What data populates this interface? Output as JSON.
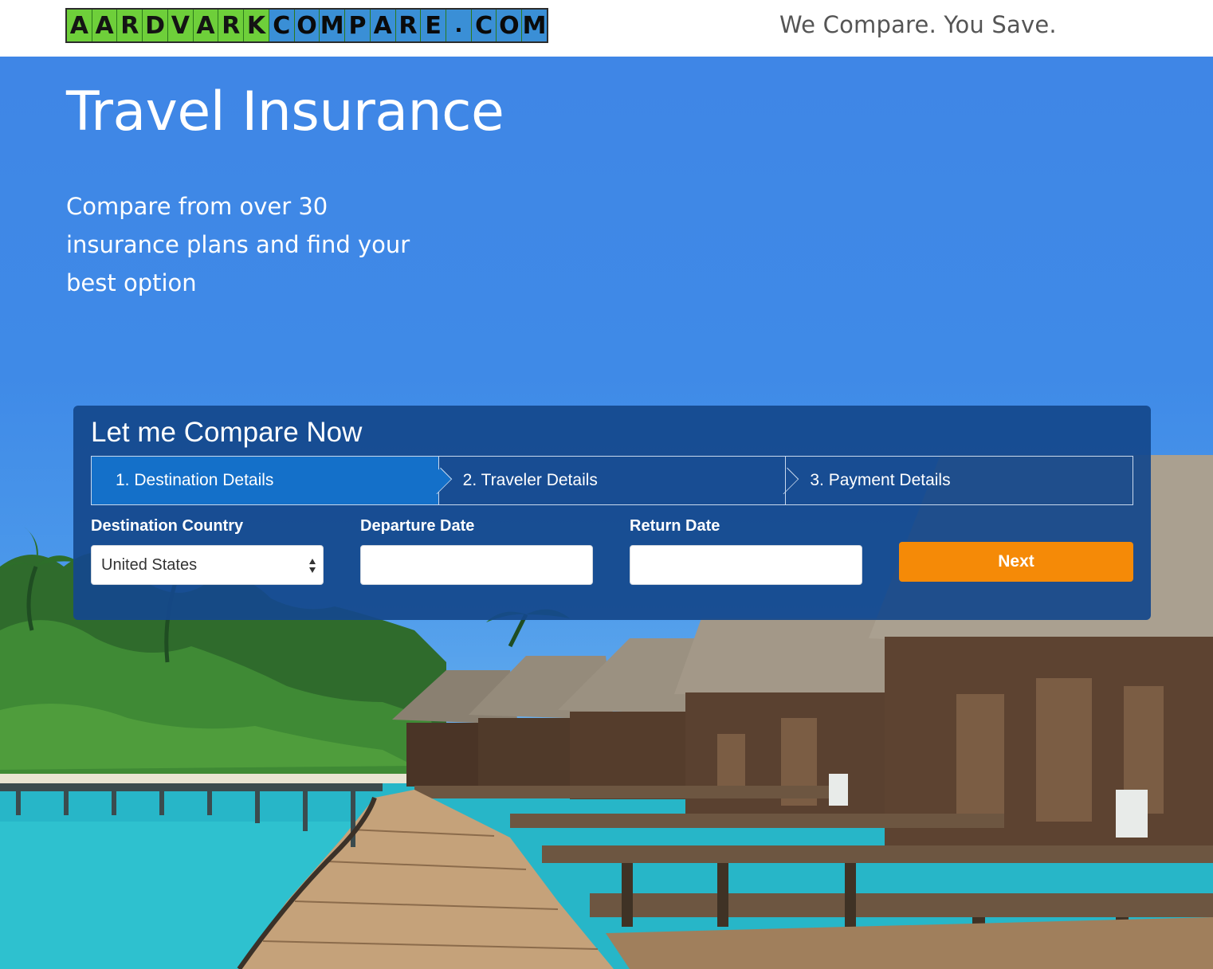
{
  "header": {
    "logo_text": "AardvarkCompare.com",
    "tagline": "We Compare. You Save."
  },
  "hero": {
    "title": "Travel Insurance",
    "subtitle": "Compare from over 30 insurance plans and find your best option"
  },
  "form": {
    "title": "Let me Compare Now",
    "steps": [
      {
        "label": "1. Destination Details",
        "active": true
      },
      {
        "label": "2. Traveler Details",
        "active": false
      },
      {
        "label": "3. Payment Details",
        "active": false
      }
    ],
    "destination": {
      "label": "Destination Country",
      "value": "United States"
    },
    "departure": {
      "label": "Departure Date",
      "value": ""
    },
    "return": {
      "label": "Return Date",
      "value": ""
    },
    "next_label": "Next"
  },
  "colors": {
    "accent": "#f58a07",
    "panel": "#14488c",
    "active_step": "#1470c9",
    "sky": "#3f86e6"
  }
}
